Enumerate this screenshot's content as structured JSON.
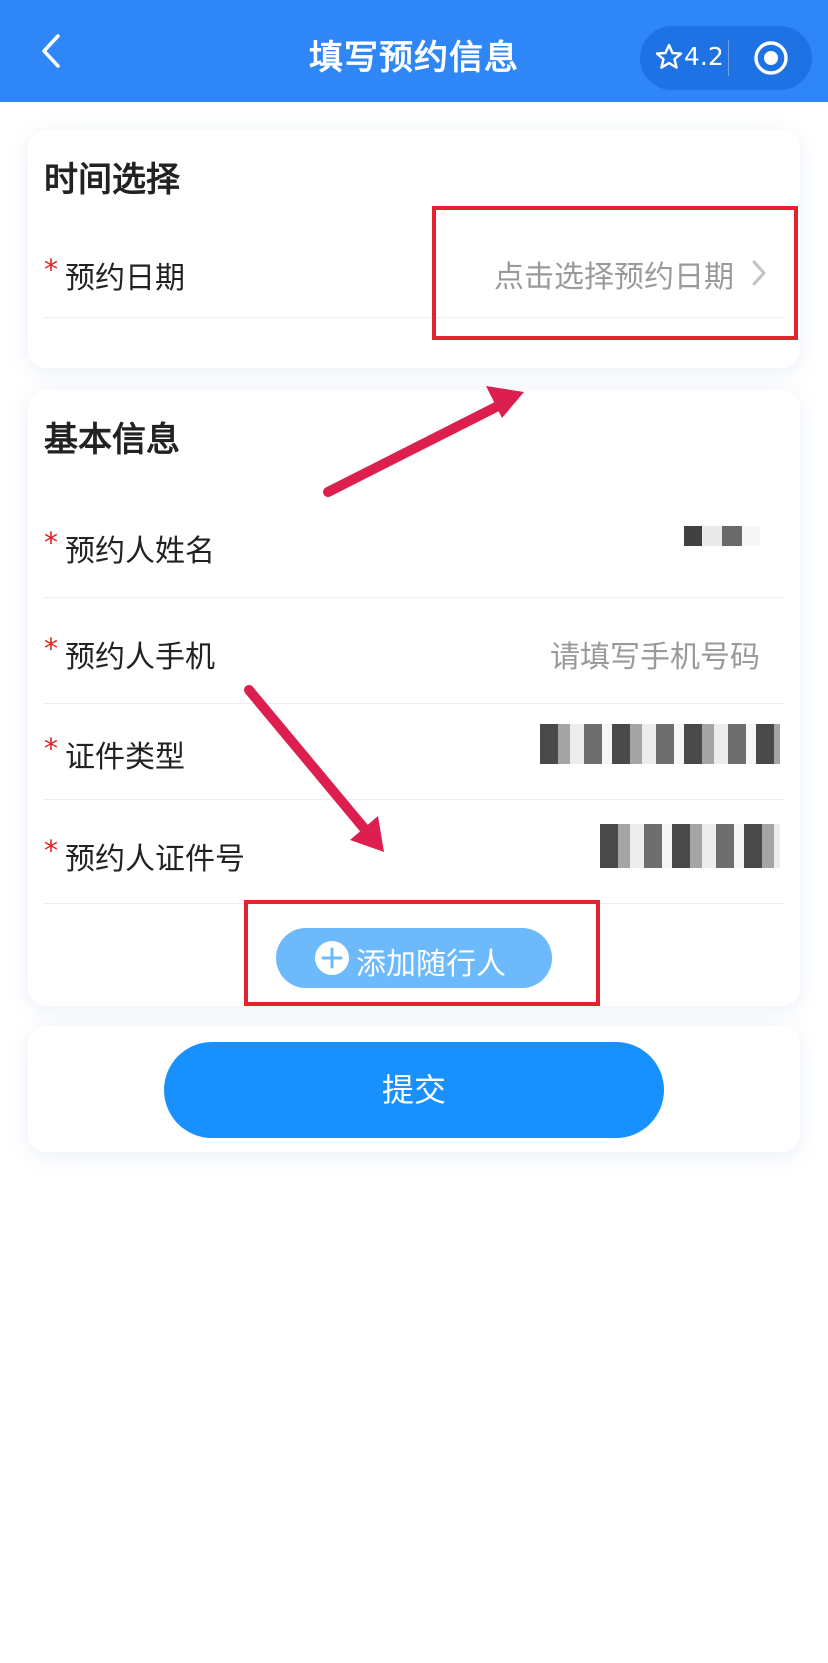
{
  "header": {
    "title": "填写预约信息",
    "rating": "4.2"
  },
  "time_section": {
    "title": "时间选择",
    "required_mark": "*",
    "date_label": "预约日期",
    "date_placeholder": "点击选择预约日期"
  },
  "basic_section": {
    "title": "基本信息",
    "required_mark": "*",
    "fields": [
      {
        "label": "预约人姓名",
        "value": ""
      },
      {
        "label": "预约人手机",
        "placeholder": "请填写手机号码"
      },
      {
        "label": "证件类型",
        "value": ""
      },
      {
        "label": "预约人证件号",
        "value": ""
      }
    ],
    "add_companion_label": "添加随行人"
  },
  "submit": {
    "label": "提交"
  },
  "colors": {
    "header_blue": "#2f87f7",
    "primary_blue": "#1890fd",
    "light_blue": "#6cb9fb",
    "required_red": "#e02020",
    "annotation_red": "#e0242e",
    "arrow_crimson": "#dc1f4f"
  },
  "icons": [
    "back-arrow-icon",
    "star-icon",
    "target-icon",
    "chevron-right-icon",
    "plus-circle-icon"
  ]
}
